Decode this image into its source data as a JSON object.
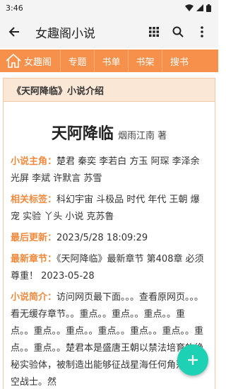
{
  "status": {
    "time": "3:46"
  },
  "app_bar": {
    "title": "女趣阁小说"
  },
  "nav": {
    "home": "女趣阁",
    "items": [
      "专题",
      "书单",
      "书架",
      "搜书"
    ]
  },
  "card": {
    "header": "《天阿降临》小说介绍",
    "book_title": "天阿降临",
    "author": "烟雨江南 著",
    "protagonist_label": "小说主角：",
    "protagonist_value": "楚君 秦奕 李若白 方玉 阿琛 李泽余 光屏 李斌 许默言 苏雪",
    "tags_label": "相关标签：",
    "tags_value": "科幻宇宙 斗极品 时代 年代 王朝 爆宠 实验 丫头 小说 克苏鲁",
    "updated_label": "最后更新：",
    "updated_value": "2023/5/28 18:09:29",
    "chapter_label": "最新章节：",
    "chapter_value": "《天阿降临》最新章节 第408章 必须尊重！ 2023-05-28",
    "intro_label": "小说简介：",
    "intro_value": "访问网页最下面。。。查看原网页。。。看无缓存章节。。重点。。重点。。重点。。重点。。重点。。重点。。重点。。重点。。重点。。重点。。重点。。楚君本是盛唐王朝以禁法培育的绝秘实验体，被制造出能够征战星海任何角落的深空战士。然"
  },
  "colors": {
    "accent": "#f7904a",
    "label": "#f08a3e",
    "fab": "#1fd1b4"
  }
}
